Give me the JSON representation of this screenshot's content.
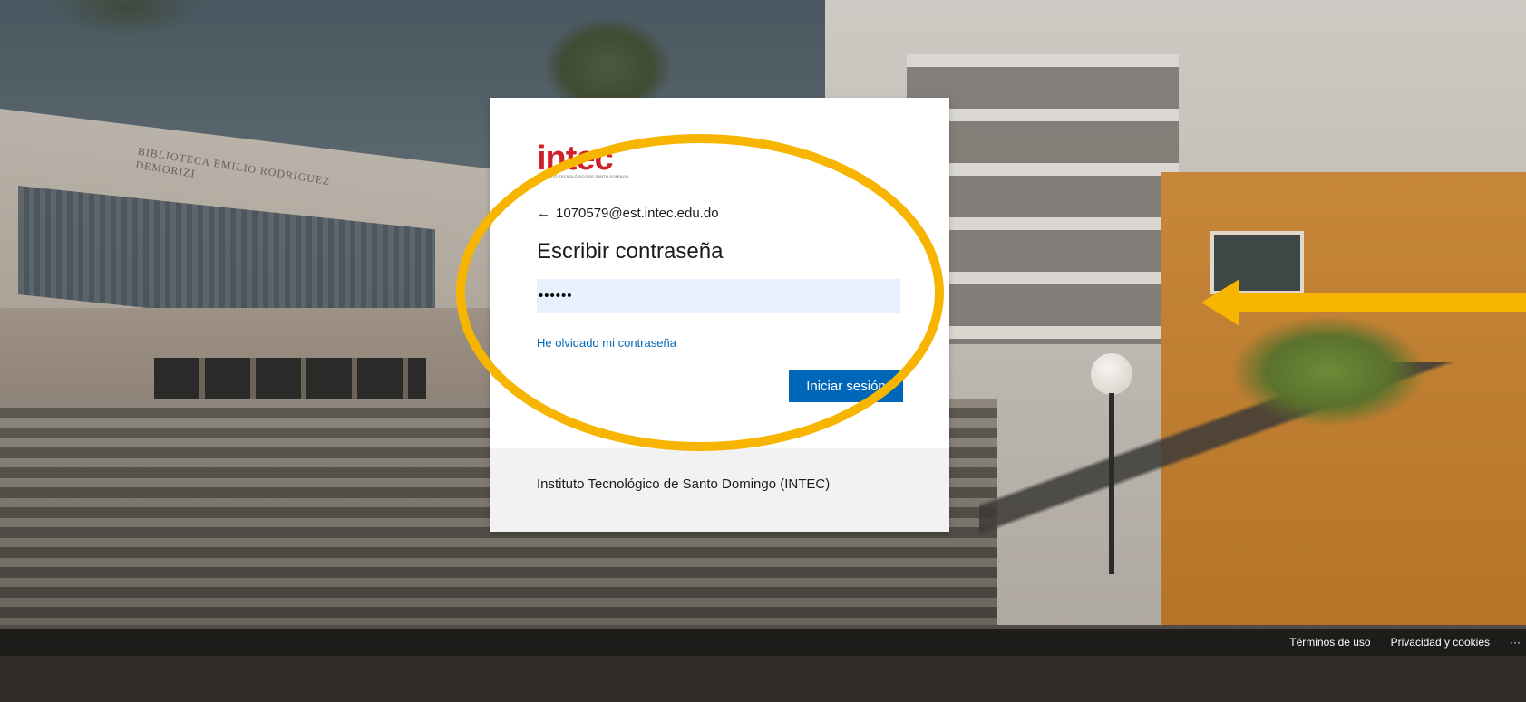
{
  "background": {
    "library_sign": "BIBLIOTECA EMILIO RODRIGUEZ DEMORIZI"
  },
  "card": {
    "logo": {
      "text": "intec",
      "subtitle": "INSTITUTO TECNOLÓGICO DE SANTO DOMINGO",
      "color": "#d0212a"
    },
    "identity": {
      "back_icon": "arrow-left-icon",
      "email": "1070579@est.intec.edu.do"
    },
    "title": "Escribir contraseña",
    "password": {
      "value": "••••••"
    },
    "forgot_link": "He olvidado mi contraseña",
    "signin_button": "Iniciar sesión",
    "org_name": "Instituto Tecnológico de Santo Domingo (INTEC)"
  },
  "footer": {
    "terms": "Términos de uso",
    "privacy": "Privacidad y cookies",
    "more": "···"
  },
  "colors": {
    "accent": "#0067b8",
    "annotation": "#f7b500",
    "brand": "#d0212a"
  }
}
